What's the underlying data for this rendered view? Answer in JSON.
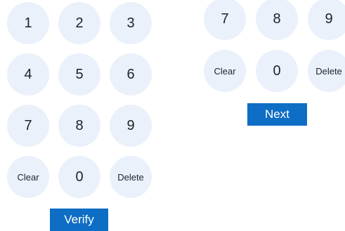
{
  "left_keypad": {
    "keys": [
      "1",
      "2",
      "3",
      "4",
      "5",
      "6",
      "7",
      "8",
      "9",
      "Clear",
      "0",
      "Delete"
    ],
    "submit_label": "Verify"
  },
  "right_keypad": {
    "keys": [
      "7",
      "8",
      "9",
      "Clear",
      "0",
      "Delete"
    ],
    "submit_label": "Next"
  },
  "colors": {
    "key_background": "#eaf1fa",
    "key_text": "#1f2328",
    "button_background": "#0e6dc4",
    "button_text": "#ffffff"
  }
}
